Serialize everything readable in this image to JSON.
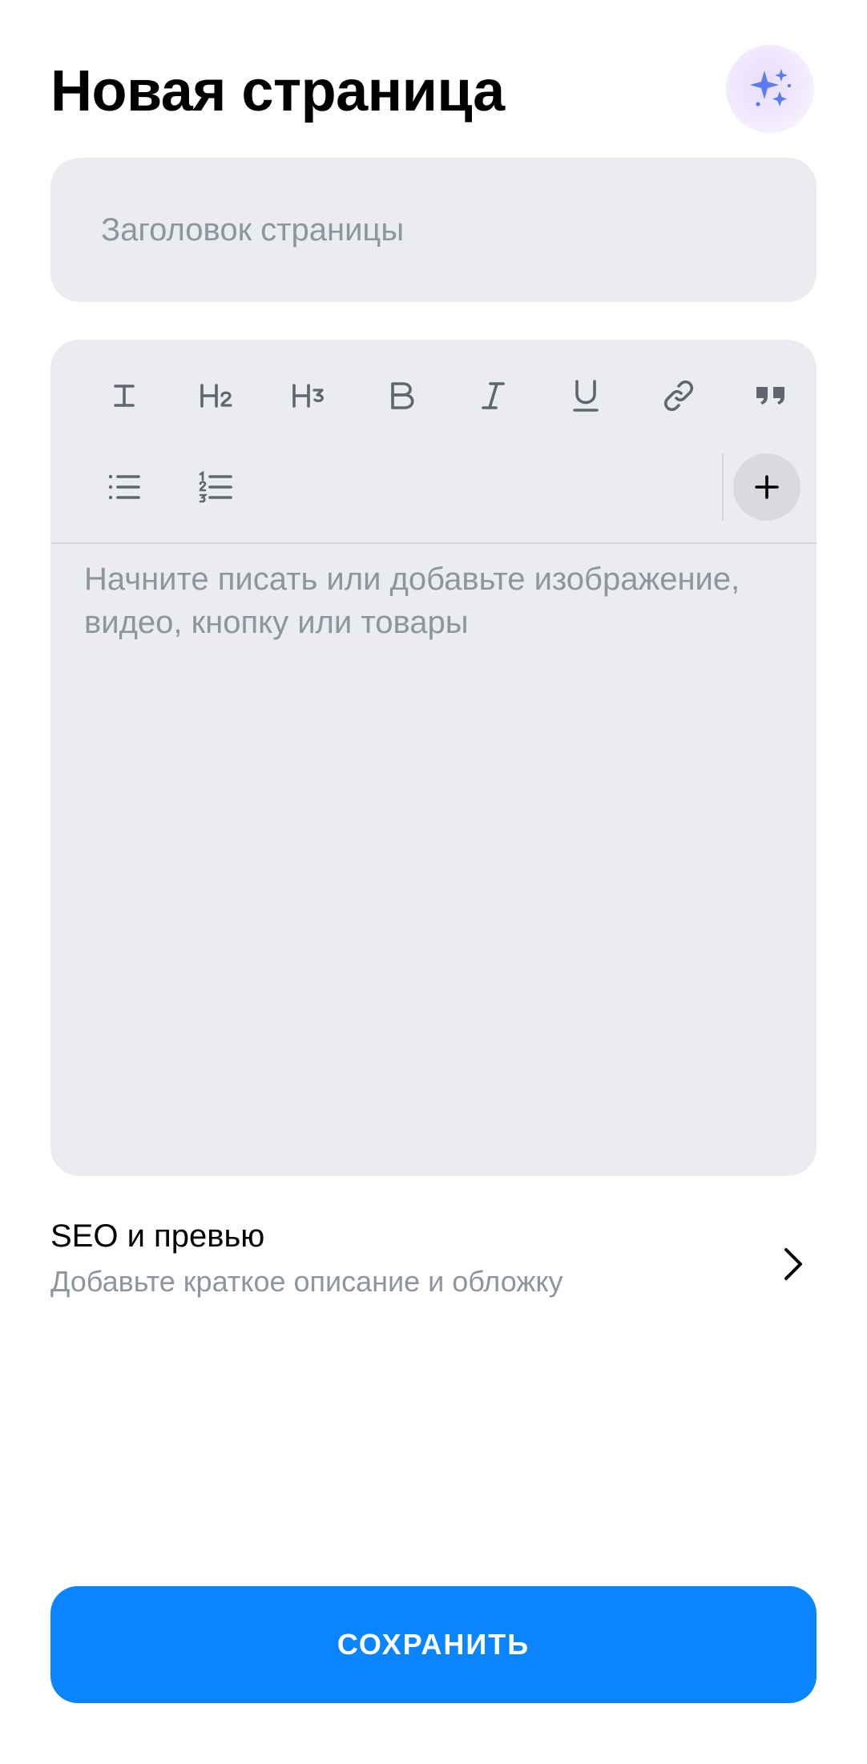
{
  "header": {
    "title": "Новая страница",
    "ai_icon": "sparkles-icon"
  },
  "title_field": {
    "placeholder": "Заголовок страницы",
    "value": ""
  },
  "toolbar": {
    "tools": [
      {
        "name": "text-format-icon",
        "row": 1
      },
      {
        "name": "heading-2-icon",
        "row": 1
      },
      {
        "name": "heading-3-icon",
        "row": 1
      },
      {
        "name": "bold-icon",
        "row": 1
      },
      {
        "name": "italic-icon",
        "row": 1
      },
      {
        "name": "underline-icon",
        "row": 1
      },
      {
        "name": "link-icon",
        "row": 1
      },
      {
        "name": "quote-icon",
        "row": 1
      },
      {
        "name": "bulleted-list-icon",
        "row": 2
      },
      {
        "name": "numbered-list-icon",
        "row": 2
      }
    ],
    "add_icon": "plus-icon"
  },
  "editor": {
    "placeholder": "Начните писать или добавьте изображение, видео, кнопку или товары"
  },
  "seo": {
    "title": "SEO и превью",
    "subtitle": "Добавьте краткое описание и обложку",
    "icon": "chevron-right-icon"
  },
  "save_button": {
    "label": "СОХРАНИТЬ"
  },
  "colors": {
    "accent": "#0a84ff",
    "field_background": "#ebecef",
    "placeholder_text": "#8f959e",
    "icon": "#5f6670",
    "ai_icon": "#5b7cf0"
  }
}
